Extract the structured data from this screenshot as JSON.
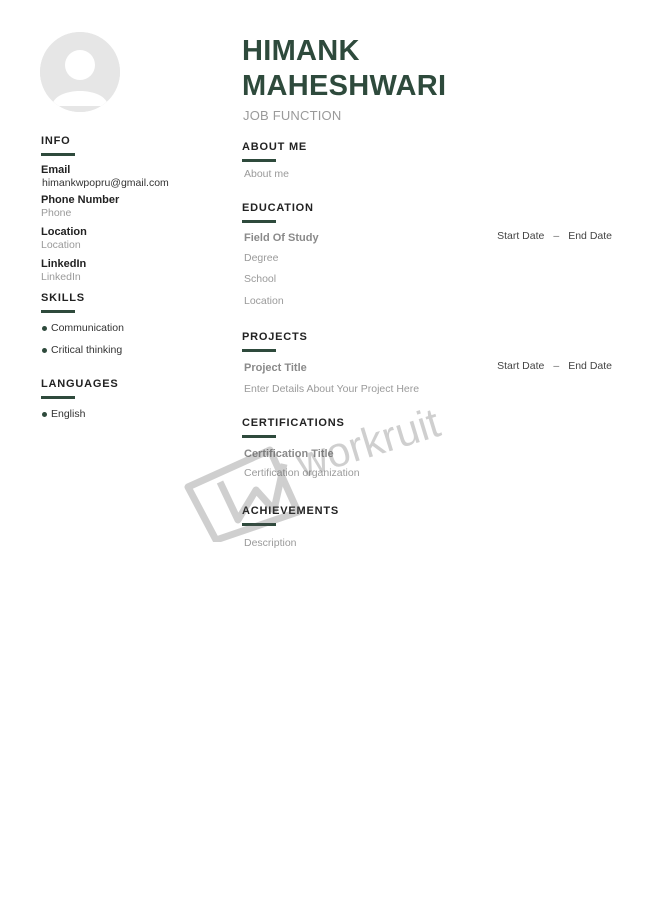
{
  "name_line1": "HIMANK",
  "name_line2": "MAHESHWARI",
  "job_function": "JOB FUNCTION",
  "info": {
    "title": "INFO",
    "email_label": "Email",
    "email_value": "himankwpopru@gmail.com",
    "phone_label": "Phone Number",
    "phone_value": "Phone",
    "location_label": "Location",
    "location_value": "Location",
    "linkedin_label": "LinkedIn",
    "linkedin_value": "LinkedIn"
  },
  "skills": {
    "title": "SKILLS",
    "items": [
      "Communication",
      "Critical thinking"
    ]
  },
  "languages": {
    "title": "LANGUAGES",
    "items": [
      "English"
    ]
  },
  "about": {
    "title": "ABOUT ME",
    "text": "About me"
  },
  "education": {
    "title": "EDUCATION",
    "field": "Field Of Study",
    "start": "Start Date",
    "dash": "–",
    "end": "End Date",
    "degree": "Degree",
    "school": "School",
    "location": "Location"
  },
  "projects": {
    "title": "PROJECTS",
    "project_title": "Project Title",
    "start": "Start Date",
    "dash": "–",
    "end": "End Date",
    "details": "Enter Details About Your Project Here"
  },
  "certifications": {
    "title": "CERTIFICATIONS",
    "cert_title": "Certification Title",
    "organization": "Certification organization"
  },
  "achievements": {
    "title": "ACHIEVEMENTS",
    "description": "Description"
  },
  "watermark_text": "workruit",
  "icons": {
    "avatar": "user-silhouette-icon",
    "watermark": "workruit-logo-icon"
  },
  "colors": {
    "accent": "#2e4a3c",
    "gray_text": "#9a9a9a",
    "avatar_bg": "#e6e6e6"
  }
}
